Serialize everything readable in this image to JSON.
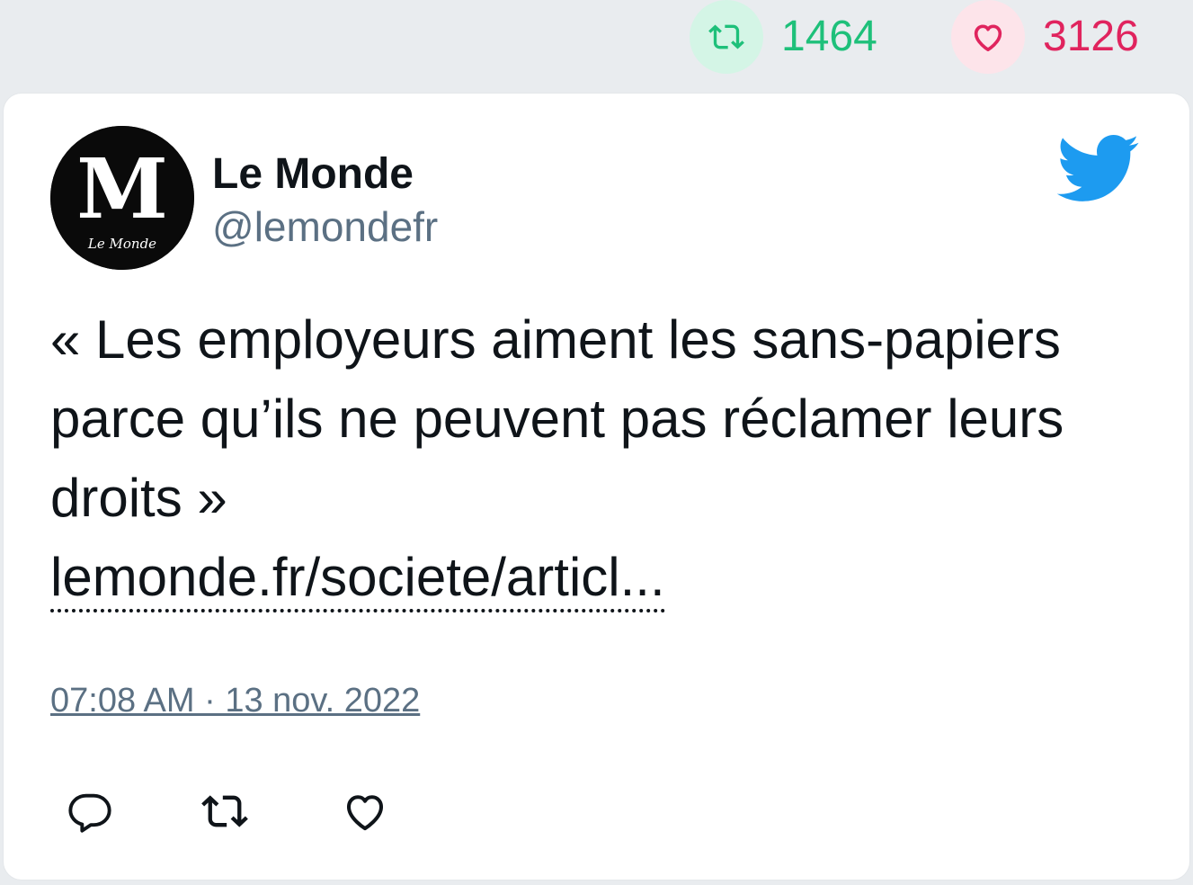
{
  "stats": {
    "retweets": "1464",
    "likes": "3126",
    "retweet_icon": "retweet-icon",
    "like_icon": "heart-icon",
    "retweet_color": "#1ec07a",
    "like_color": "#e0245e"
  },
  "author": {
    "name": "Le Monde",
    "handle": "@lemondefr",
    "avatar_logo_text": "Le Monde",
    "avatar_monogram": "M"
  },
  "tweet": {
    "text": "« Les employeurs aiment les sans-papiers parce qu’ils ne peuvent pas réclamer leurs droits »",
    "link": "lemonde.fr/societe/articl...",
    "timestamp": "07:08 AM · 13 nov. 2022"
  },
  "actions": [
    {
      "name": "reply",
      "icon": "reply-icon"
    },
    {
      "name": "retweet",
      "icon": "retweet-icon"
    },
    {
      "name": "like",
      "icon": "heart-icon"
    }
  ],
  "brand": {
    "twitter_color": "#1d9bf0",
    "icon": "twitter-bird-icon"
  }
}
